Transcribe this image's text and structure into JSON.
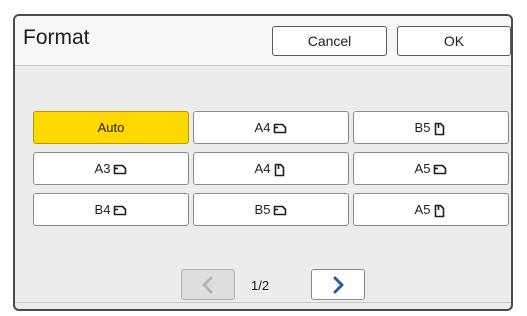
{
  "header": {
    "title": "Format",
    "cancel_label": "Cancel",
    "ok_label": "OK"
  },
  "formats": [
    {
      "label": "Auto",
      "orientation": "none",
      "selected": true
    },
    {
      "label": "A4",
      "orientation": "landscape",
      "selected": false
    },
    {
      "label": "B5",
      "orientation": "portrait",
      "selected": false
    },
    {
      "label": "A3",
      "orientation": "landscape",
      "selected": false
    },
    {
      "label": "A4",
      "orientation": "portrait",
      "selected": false
    },
    {
      "label": "A5",
      "orientation": "landscape",
      "selected": false
    },
    {
      "label": "B4",
      "orientation": "landscape",
      "selected": false
    },
    {
      "label": "B5",
      "orientation": "landscape",
      "selected": false
    },
    {
      "label": "A5",
      "orientation": "portrait",
      "selected": false
    }
  ],
  "pagination": {
    "page_text": "1/2",
    "prev_enabled": false,
    "next_enabled": true
  },
  "colors": {
    "selected": "#ffd800",
    "panel_bg": "#ececec",
    "border": "#4a4a4a"
  }
}
